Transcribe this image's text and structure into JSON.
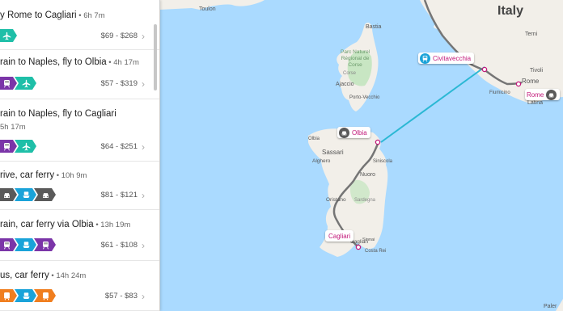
{
  "sidebar": {
    "routes": [
      {
        "title": "y Rome to Cagliari",
        "duration": "6h 7m",
        "price": "$69 - $268",
        "modes": [
          "plane"
        ]
      },
      {
        "title": "rain to Naples, fly to Olbia",
        "duration": "4h 17m",
        "price": "$57 - $319",
        "modes": [
          "train",
          "plane"
        ]
      },
      {
        "title": "rain to Naples, fly to Cagliari",
        "duration": "5h 17m",
        "price": "$64 - $251",
        "modes": [
          "train",
          "plane"
        ]
      },
      {
        "title": "rive, car ferry",
        "duration": "10h 9m",
        "price": "$81 - $121",
        "modes": [
          "car",
          "ferry",
          "car"
        ]
      },
      {
        "title": "rain, car ferry via Olbia",
        "duration": "13h 19m",
        "price": "$61 - $108",
        "modes": [
          "train",
          "ferry",
          "train"
        ]
      },
      {
        "title": "us, car ferry",
        "duration": "14h 24m",
        "price": "$57 - $83",
        "modes": [
          "bus",
          "ferry",
          "bus"
        ]
      }
    ],
    "separator": "•",
    "chevron": "›"
  },
  "map": {
    "labels": {
      "toulon": "Toulon",
      "italy": "Italy",
      "bastia": "Bastia",
      "park": "Parc Naturel\nRégional de\nCorse",
      "ajaccio": "Ajaccio",
      "porto_vecchio": "Porto-Vecchio",
      "corse": "Corse",
      "sassari": "Sassari",
      "alghero": "Alghero",
      "nuoro": "Nuoro",
      "oristano": "Oristano",
      "sardegna": "Sardegna",
      "cagliari_town": "Cagliari",
      "costa_rei": "Costa Rei",
      "terni": "Terni",
      "tivoli": "Tivoli",
      "rome_city": "Rome",
      "fiumicino": "Fiumicino",
      "latina": "Latina",
      "siniscola": "Siniscola",
      "sinnai": "Sinnai",
      "olbia_small": "Olbia",
      "palermo": "Paler"
    },
    "stops": {
      "civitavecchia": "Civitavecchia",
      "rome": "Rome",
      "olbia": "Olbia",
      "cagliari": "Cagliari"
    }
  },
  "colors": {
    "sea": "#aadaff",
    "land": "#f2efe9",
    "park": "#c8e6c3",
    "route": "#757575",
    "ferry_line": "#2bb8d4",
    "stop_text": "#c2187a",
    "teal": "#1fbfa8",
    "purple": "#7b35a8",
    "gray": "#5a5a5a",
    "blue": "#1aa3d9",
    "orange": "#f07e1f"
  }
}
